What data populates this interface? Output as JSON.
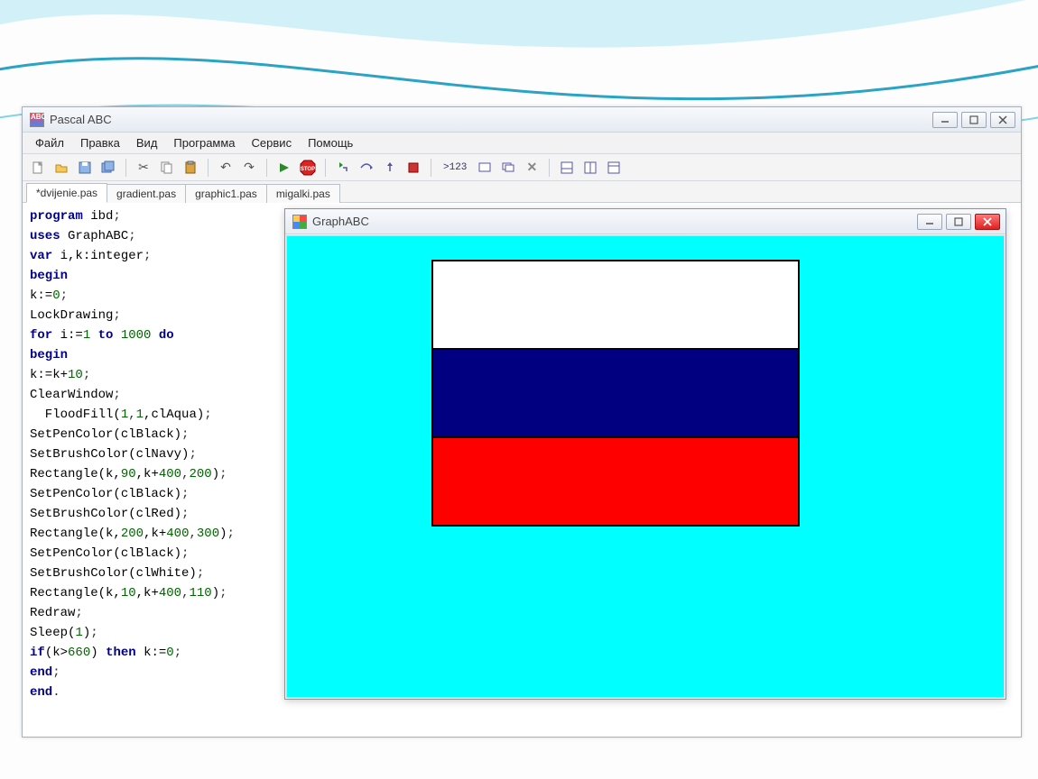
{
  "app": {
    "title": "Pascal ABC"
  },
  "menu": {
    "file": "Файл",
    "edit": "Правка",
    "view": "Вид",
    "program": "Программа",
    "service": "Сервис",
    "help": "Помощь"
  },
  "tabs": [
    {
      "label": "*dvijenie.pas",
      "active": true
    },
    {
      "label": "gradient.pas",
      "active": false
    },
    {
      "label": "graphic1.pas",
      "active": false
    },
    {
      "label": "migalki.pas",
      "active": false
    }
  ],
  "code_lines": [
    {
      "tokens": [
        [
          "kw",
          "program"
        ],
        [
          "id",
          " ibd"
        ],
        [
          "punct",
          ";"
        ]
      ]
    },
    {
      "tokens": [
        [
          "kw",
          "uses"
        ],
        [
          "id",
          " GraphABC"
        ],
        [
          "punct",
          ";"
        ]
      ]
    },
    {
      "tokens": [
        [
          "kw",
          "var"
        ],
        [
          "id",
          " i,k:integer"
        ],
        [
          "punct",
          ";"
        ]
      ]
    },
    {
      "tokens": [
        [
          "kw",
          "begin"
        ]
      ]
    },
    {
      "tokens": [
        [
          "id",
          "k:="
        ],
        [
          "num",
          "0"
        ],
        [
          "punct",
          ";"
        ]
      ]
    },
    {
      "tokens": [
        [
          "id",
          "LockDrawing"
        ],
        [
          "punct",
          ";"
        ]
      ]
    },
    {
      "tokens": [
        [
          "kw",
          "for"
        ],
        [
          "id",
          " i:="
        ],
        [
          "num",
          "1"
        ],
        [
          "kw",
          " to "
        ],
        [
          "num",
          "1000"
        ],
        [
          "kw",
          " do"
        ]
      ]
    },
    {
      "tokens": [
        [
          "kw",
          "begin"
        ]
      ]
    },
    {
      "tokens": [
        [
          "id",
          "k:=k+"
        ],
        [
          "num",
          "10"
        ],
        [
          "punct",
          ";"
        ]
      ]
    },
    {
      "tokens": [
        [
          "id",
          "ClearWindow"
        ],
        [
          "punct",
          ";"
        ]
      ]
    },
    {
      "tokens": [
        [
          "id",
          "  FloodFill("
        ],
        [
          "num",
          "1"
        ],
        [
          "punct",
          ","
        ],
        [
          "num",
          "1"
        ],
        [
          "id",
          ",clAqua)"
        ],
        [
          "punct",
          ";"
        ]
      ]
    },
    {
      "tokens": [
        [
          "id",
          "SetPenColor(clBlack)"
        ],
        [
          "punct",
          ";"
        ]
      ]
    },
    {
      "tokens": [
        [
          "id",
          "SetBrushColor(clNavy)"
        ],
        [
          "punct",
          ";"
        ]
      ]
    },
    {
      "tokens": [
        [
          "id",
          "Rectangle(k,"
        ],
        [
          "num",
          "90"
        ],
        [
          "id",
          ",k+"
        ],
        [
          "num",
          "400"
        ],
        [
          "punct",
          ","
        ],
        [
          "num",
          "200"
        ],
        [
          "id",
          ")"
        ],
        [
          "punct",
          ";"
        ]
      ]
    },
    {
      "tokens": [
        [
          "id",
          "SetPenColor(clBlack)"
        ],
        [
          "punct",
          ";"
        ]
      ]
    },
    {
      "tokens": [
        [
          "id",
          "SetBrushColor(clRed)"
        ],
        [
          "punct",
          ";"
        ]
      ]
    },
    {
      "tokens": [
        [
          "id",
          "Rectangle(k,"
        ],
        [
          "num",
          "200"
        ],
        [
          "id",
          ",k+"
        ],
        [
          "num",
          "400"
        ],
        [
          "punct",
          ","
        ],
        [
          "num",
          "300"
        ],
        [
          "id",
          ")"
        ],
        [
          "punct",
          ";"
        ]
      ]
    },
    {
      "tokens": [
        [
          "id",
          "SetPenColor(clBlack)"
        ],
        [
          "punct",
          ";"
        ]
      ]
    },
    {
      "tokens": [
        [
          "id",
          "SetBrushColor(clWhite)"
        ],
        [
          "punct",
          ";"
        ]
      ]
    },
    {
      "tokens": [
        [
          "id",
          "Rectangle(k,"
        ],
        [
          "num",
          "10"
        ],
        [
          "id",
          ",k+"
        ],
        [
          "num",
          "400"
        ],
        [
          "punct",
          ","
        ],
        [
          "num",
          "110"
        ],
        [
          "id",
          ")"
        ],
        [
          "punct",
          ";"
        ]
      ]
    },
    {
      "tokens": [
        [
          "id",
          "Redraw"
        ],
        [
          "punct",
          ";"
        ]
      ]
    },
    {
      "tokens": [
        [
          "id",
          "Sleep("
        ],
        [
          "num",
          "1"
        ],
        [
          "id",
          ")"
        ],
        [
          "punct",
          ";"
        ]
      ]
    },
    {
      "tokens": [
        [
          "kw",
          "if"
        ],
        [
          "id",
          "(k>"
        ],
        [
          "num",
          "660"
        ],
        [
          "id",
          ") "
        ],
        [
          "kw",
          "then"
        ],
        [
          "id",
          " k:="
        ],
        [
          "num",
          "0"
        ],
        [
          "punct",
          ";"
        ]
      ]
    },
    {
      "tokens": [
        [
          "kw",
          "end"
        ],
        [
          "punct",
          ";"
        ]
      ]
    },
    {
      "tokens": [
        [
          "kw",
          "end"
        ],
        [
          "punct",
          "."
        ]
      ]
    }
  ],
  "graph_window": {
    "title": "GraphABC"
  },
  "toolbar_var_label": ">123",
  "colors": {
    "aqua": "#00ffff",
    "navy": "#000080",
    "red": "#ff0000",
    "white": "#ffffff",
    "black": "#000000"
  }
}
